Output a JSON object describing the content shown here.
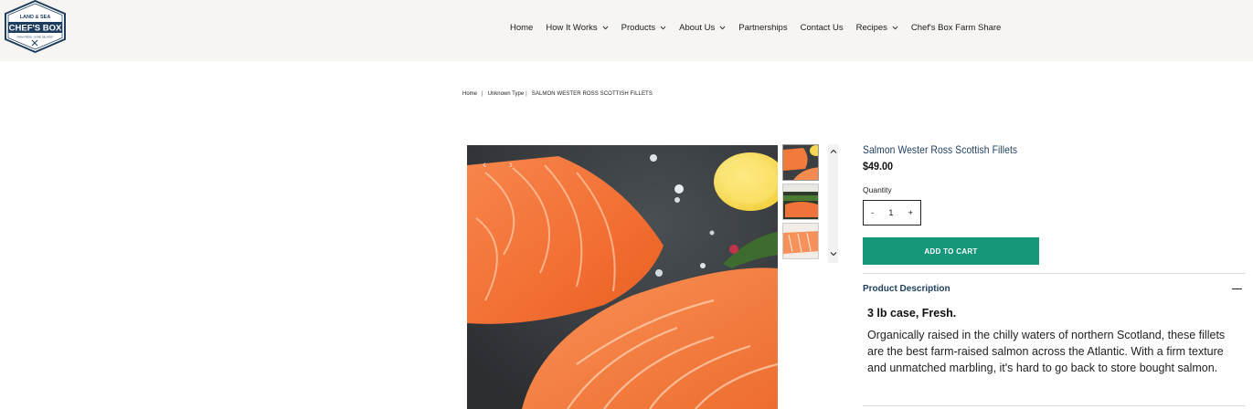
{
  "logo": {
    "top_text": "LAND & SEA",
    "main_text": "CHEF'S BOX",
    "tagline": "FARM FRESH · HOME DELIVERY"
  },
  "nav": {
    "items": [
      {
        "label": "Home",
        "has_dropdown": false
      },
      {
        "label": "How It Works",
        "has_dropdown": true
      },
      {
        "label": "Products",
        "has_dropdown": true
      },
      {
        "label": "About Us",
        "has_dropdown": true
      },
      {
        "label": "Partnerships",
        "has_dropdown": false
      },
      {
        "label": "Contact Us",
        "has_dropdown": false
      },
      {
        "label": "Recipes",
        "has_dropdown": true
      },
      {
        "label": "Chef's Box Farm Share",
        "has_dropdown": false
      }
    ]
  },
  "breadcrumb": {
    "home": "Home",
    "type": "Unknown Type",
    "current": "SALMON WESTER ROSS SCOTTISH FILLETS"
  },
  "gallery": {
    "prev_arrow": "‹",
    "next_arrow": "›",
    "thumbnail_count": 3
  },
  "product": {
    "title": "Salmon Wester Ross Scottish Fillets",
    "price": "$49.00",
    "quantity_label": "Quantity",
    "quantity_value": "1",
    "decrement": "-",
    "increment": "+",
    "add_to_cart_label": "ADD TO CART"
  },
  "description": {
    "heading": "Product Description",
    "subheading": "3 lb case, Fresh.",
    "body": "Organically raised in the chilly waters of northern Scotland, these fillets are the best farm-raised salmon across the Atlantic. With a firm texture and unmatched marbling, it's hard to go back to store bought salmon."
  },
  "colors": {
    "header_bg": "#f6f5f1",
    "accent_green": "#16977a",
    "title_navy": "#1c3d5e"
  }
}
